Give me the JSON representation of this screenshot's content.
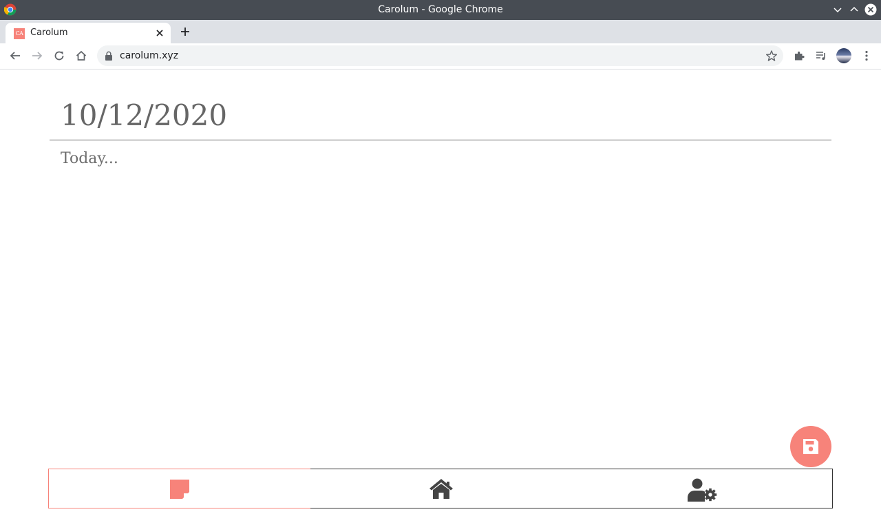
{
  "window": {
    "title": "Carolum - Google Chrome"
  },
  "browser": {
    "tab": {
      "title": "Carolum",
      "favicon_text": "CA"
    },
    "url": "carolum.xyz"
  },
  "entry": {
    "date": "10/12/2020",
    "placeholder": "Today..."
  },
  "nav": {
    "items": [
      {
        "icon": "sticky-note-icon",
        "active": true
      },
      {
        "icon": "home-icon",
        "active": false
      },
      {
        "icon": "user-settings-icon",
        "active": false
      }
    ]
  },
  "colors": {
    "accent": "#f7837a",
    "text": "#666666",
    "icon": "#444444",
    "titlebar": "#474c53"
  }
}
